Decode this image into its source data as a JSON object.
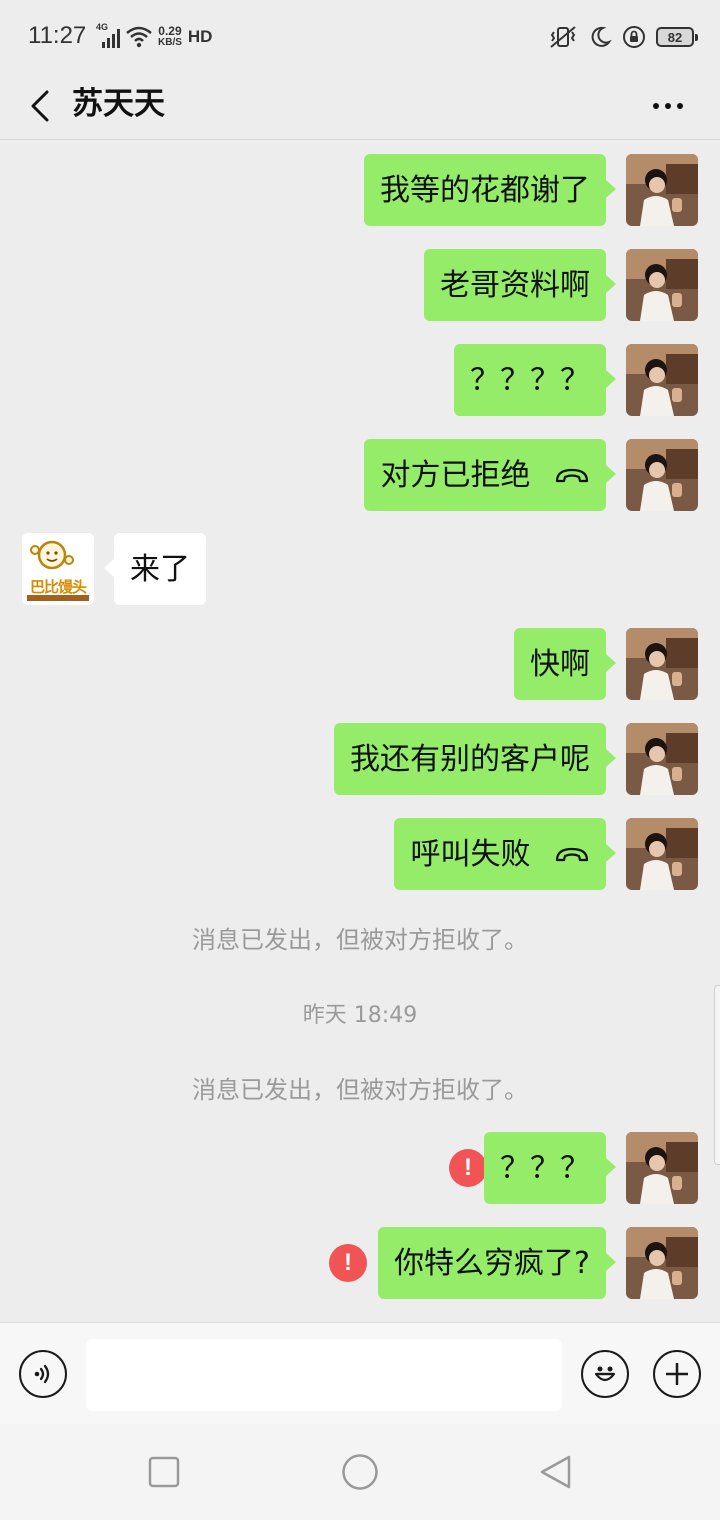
{
  "status_bar": {
    "time": "11:27",
    "network_type": "4G",
    "speed_value": "0.29",
    "speed_unit": "KB/S",
    "hd_label": "HD",
    "battery_level": "82"
  },
  "header": {
    "back_icon": "chevron-left-icon",
    "title": "苏天天",
    "more_icon": "more-dots-icon"
  },
  "messages": [
    {
      "sender": "me",
      "text": "我等的花都谢了"
    },
    {
      "sender": "me",
      "text": "老哥资料啊"
    },
    {
      "sender": "me",
      "text": "？？？？"
    },
    {
      "sender": "me",
      "text": "对方已拒绝",
      "icon": "call-declined-icon"
    },
    {
      "sender": "them",
      "text": "来了"
    },
    {
      "sender": "me",
      "text": "快啊"
    },
    {
      "sender": "me",
      "text": "我还有别的客户呢"
    },
    {
      "sender": "me",
      "text": "呼叫失败",
      "icon": "call-failed-icon"
    },
    {
      "type": "system",
      "text": "消息已发出，但被对方拒收了。"
    },
    {
      "type": "timestamp",
      "text": "昨天 18:49"
    },
    {
      "type": "system",
      "text": "消息已发出，但被对方拒收了。"
    },
    {
      "sender": "me",
      "text": "？？？",
      "error": true
    },
    {
      "sender": "me",
      "text": "你特么穷疯了?",
      "error": true
    }
  ],
  "error_mark": "!",
  "their_avatar_logo_text": "巴比馒头",
  "input_bar": {
    "voice_icon": "voice-icon",
    "message_value": "",
    "emoji_icon": "emoji-icon",
    "plus_icon": "plus-icon"
  },
  "nav_bar": {
    "recent_icon": "square-icon",
    "home_icon": "circle-icon",
    "back_icon": "triangle-back-icon"
  },
  "colors": {
    "my_bubble": "#95ec69",
    "their_bubble": "#ffffff",
    "background": "#ededed",
    "error_badge": "#f05454"
  }
}
